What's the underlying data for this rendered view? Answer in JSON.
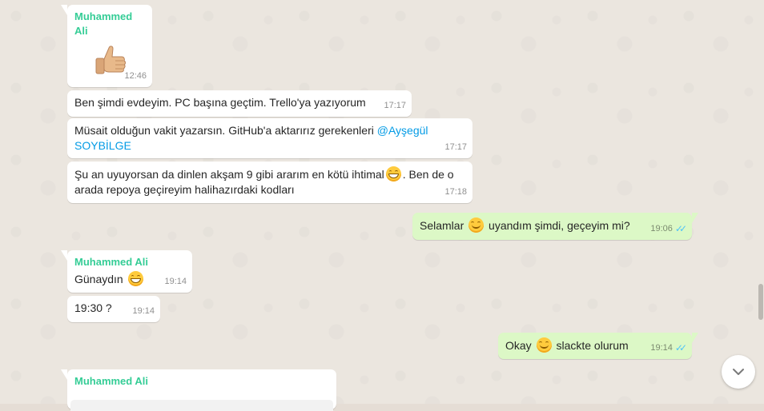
{
  "messages": [
    {
      "sender": "Muhammed Ali",
      "time": "12:46",
      "thumb_emoji": "thumbs-up"
    },
    {
      "text": "Ben şimdi evdeyim. PC başına geçtim. Trello'ya yazıyorum",
      "time": "17:17"
    },
    {
      "text": "Müsait olduğun vakit yazarsın. GitHub'a aktarırız gerekenleri",
      "mention_a": "@Ayşegül",
      "mention_b": "SOYBİLGE",
      "time": "17:17"
    },
    {
      "text_a": "Şu an uyuyorsan da dinlen akşam 9 gibi ararım en kötü ihtimal",
      "text_b": ". Ben de o",
      "text_c": "arada repoya geçireyim halihazırdaki kodları",
      "time": "17:18"
    },
    {
      "text_a": "Selamlar",
      "text_b": "uyandım şimdi, geçeyim mi?",
      "time": "19:06",
      "ticks": "✓✓"
    },
    {
      "sender": "Muhammed Ali",
      "text": "Günaydın",
      "time": "19:14"
    },
    {
      "text": "19:30 ?",
      "time": "19:14"
    },
    {
      "text_a": "Okay",
      "text_b": "slackte olurum",
      "time": "19:14",
      "ticks": "✓✓"
    },
    {
      "sender": "Muhammed Ali"
    }
  ],
  "colors": {
    "incoming": "#ffffff",
    "outgoing": "#dcf8c6",
    "sender": "#35cd96",
    "mention": "#039be5",
    "read_ticks": "#4fc3f7"
  }
}
